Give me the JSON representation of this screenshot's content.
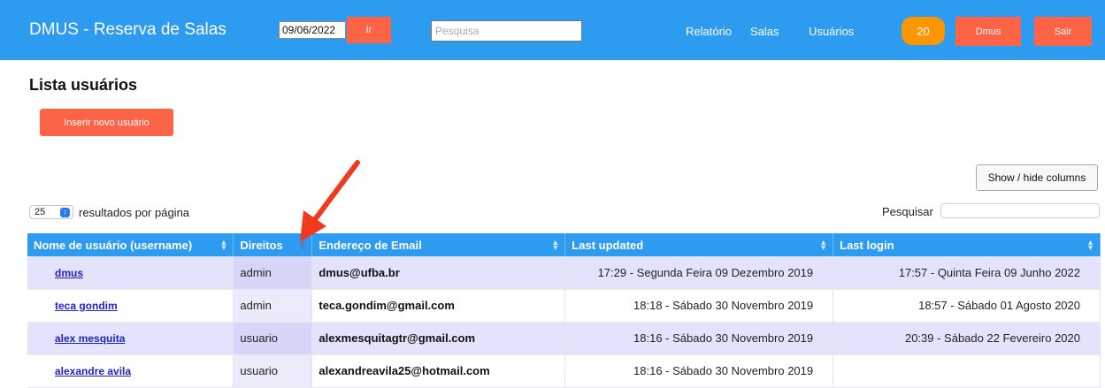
{
  "header": {
    "brand": "DMUS - Reserva de Salas",
    "date_value": "09/06/2022",
    "go_label": "Ir",
    "search_placeholder": "Pesquisa",
    "nav": [
      "Relatório",
      "Salas",
      "Usuários"
    ],
    "badge_count": "20",
    "user_button": "Dmus",
    "logout_button": "Sair"
  },
  "page": {
    "title": "Lista usuários",
    "insert_button": "Inserir novo usuário",
    "columns_button": "Show / hide columns",
    "per_page_value": "25",
    "per_page_label": "resultados por página",
    "search_label": "Pesquisar"
  },
  "table": {
    "headers": [
      "Nome de usuário (username)",
      "Direitos",
      "Endereço de Email",
      "Last updated",
      "Last login"
    ],
    "rows": [
      {
        "user": "dmus",
        "rights": "admin",
        "email": "dmus@ufba.br",
        "updated": "17:29 - Segunda Feira 09 Dezembro 2019",
        "login": "17:57 - Quinta Feira 09 Junho 2022"
      },
      {
        "user": "teca gondim",
        "rights": "admin",
        "email": "teca.gondim@gmail.com",
        "updated": "18:18 - Sábado 30 Novembro 2019",
        "login": "18:57 - Sábado 01 Agosto 2020"
      },
      {
        "user": "alex mesquita",
        "rights": "usuario",
        "email": "alexmesquitagtr@gmail.com",
        "updated": "18:16 - Sábado 30 Novembro 2019",
        "login": "20:39 - Sábado 22 Fevereiro 2020"
      },
      {
        "user": "alexandre avila",
        "rights": "usuario",
        "email": "alexandreavila25@hotmail.com",
        "updated": "18:16 - Sábado 30 Novembro 2019",
        "login": ""
      }
    ]
  },
  "colors": {
    "header_blue": "#2d9bf0",
    "button_red": "#fd6447",
    "badge_orange": "#ff9500",
    "annotation_arrow": "#f03a1e"
  },
  "icons": {
    "sort": "sort-icon",
    "select": "chevron-updown-icon",
    "annotation": "red-arrow-icon"
  }
}
